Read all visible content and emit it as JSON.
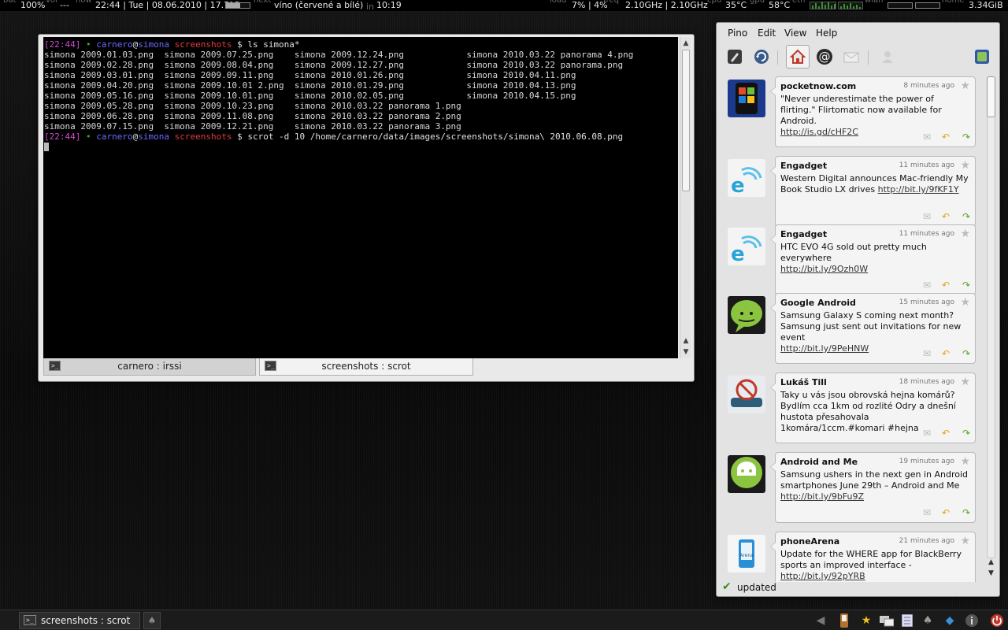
{
  "topbar": {
    "bat_label": "bat",
    "bat_value": "100%",
    "vol_label": "vol",
    "vol_value": "---",
    "now_label": "now",
    "datetime": "22:44 | Tue | 08.06.2010 | 17.7°C",
    "next_label": "next",
    "next_value": "víno (červené a bílé)",
    "in_label": "in",
    "in_value": "10:19",
    "load_label": "load",
    "load_value": "7% | 4%",
    "freq_label": "freq",
    "freq_value": "2.10GHz | 2.10GHz",
    "cpu_label": "cpu",
    "cpu_value": "35°C",
    "gpu_label": "gpu",
    "gpu_value": "58°C",
    "eth_label": "eth",
    "wlan_label": "wlan",
    "home_label": "home",
    "home_value": "3.34GiB"
  },
  "terminal": {
    "lines": [
      "simona 2009.01.03.png  simona 2009.07.25.png    simona 2009.12.24.png            simona 2010.03.22 panorama 4.png",
      "simona 2009.02.28.png  simona 2009.08.04.png    simona 2009.12.27.png            simona 2010.03.22 panorama.png",
      "simona 2009.03.01.png  simona 2009.09.11.png    simona 2010.01.26.png            simona 2010.04.11.png",
      "simona 2009.04.20.png  simona 2009.10.01 2.png  simona 2010.01.29.png            simona 2010.04.13.png",
      "simona 2009.05.16.png  simona 2009.10.01.png    simona 2010.02.05.png            simona 2010.04.15.png",
      "simona 2009.05.28.png  simona 2009.10.23.png    simona 2010.03.22 panorama 1.png",
      "simona 2009.06.28.png  simona 2009.11.08.png    simona 2010.03.22 panorama 2.png",
      "simona 2009.07.15.png  simona 2009.12.21.png    simona 2010.03.22 panorama 3.png"
    ],
    "prompt1": {
      "time": "[22:44]",
      "dot": "•",
      "user": "carnero",
      "at": "@",
      "host": "simona",
      "dir": "screenshots",
      "cmd": "$ ls simona*"
    },
    "prompt2": {
      "time": "[22:44]",
      "dot": "•",
      "user": "carnero",
      "at": "@",
      "host": "simona",
      "dir": "screenshots",
      "cmd": "$ scrot -d 10 /home/carnero/data/images/screenshots/simona\\ 2010.06.08.png"
    },
    "tabs": [
      {
        "label": "carnero : irssi"
      },
      {
        "label": "screenshots : scrot"
      }
    ]
  },
  "pino": {
    "menu": [
      "Pino",
      "Edit",
      "View",
      "Help"
    ],
    "toolbar_icons": [
      "compose-icon",
      "refresh-icon",
      "home-timeline-icon",
      "mentions-icon",
      "direct-messages-icon",
      "user-icon",
      "preferences-icon"
    ],
    "tweets": [
      {
        "author": "pocketnow.com",
        "time": "8 minutes ago",
        "text": "\"Never underestimate the power of flirting.\" Flirtomatic now available for Android.",
        "link": "http://is.gd/cHF2C",
        "avatar": "pocketnow-avatar"
      },
      {
        "author": "Engadget",
        "time": "11 minutes ago",
        "text": "Western Digital announces Mac-friendly My Book Studio LX drives",
        "link": "http://bit.ly/9fKF1Y",
        "avatar": "engadget-avatar"
      },
      {
        "author": "Engadget",
        "time": "11 minutes ago",
        "text": "HTC EVO 4G sold out pretty much everywhere",
        "link": "http://bit.ly/9Ozh0W",
        "avatar": "engadget-avatar"
      },
      {
        "author": "Google Android",
        "time": "15 minutes ago",
        "text": "Samsung Galaxy S coming next month? Samsung just sent out invitations for new event",
        "link": "http://bit.ly/9PeHNW",
        "avatar": "google-android-avatar"
      },
      {
        "author": "Lukáš Till",
        "time": "18 minutes ago",
        "text": "Taky u vás jsou obrovská hejna komárů? Bydlím cca 1km od rozlité Odry a dnešní hustota přesahovala 1komára/1ccm.#komari #hejna",
        "link": "",
        "avatar": "lukas-till-avatar"
      },
      {
        "author": "Android and Me",
        "time": "19 minutes ago",
        "text": "Samsung ushers in the next gen in Android smartphones June 29th – Android and Me",
        "link": "http://bit.ly/9bFu9Z",
        "avatar": "android-and-me-avatar"
      },
      {
        "author": "phoneArena",
        "time": "21 minutes ago",
        "text": "Update for the WHERE app for BlackBerry sports an improved interface -",
        "link": "http://bit.ly/92pYRB",
        "avatar": "phonearena-avatar"
      }
    ],
    "status": "updated"
  },
  "taskbar": {
    "task_label": "screenshots : scrot",
    "tray_icons": [
      "back-icon",
      "phone-icon",
      "star-icon",
      "network-icon",
      "notes-icon",
      "pino-icon",
      "dropbox-icon",
      "info-icon",
      "power-icon"
    ]
  },
  "colors": {
    "prompt_time": "#d24ad2",
    "prompt_user": "#6b6bff",
    "prompt_dir": "#e03c3c",
    "reply_orange": "#e5a21a",
    "retweet_green": "#58a61c"
  }
}
